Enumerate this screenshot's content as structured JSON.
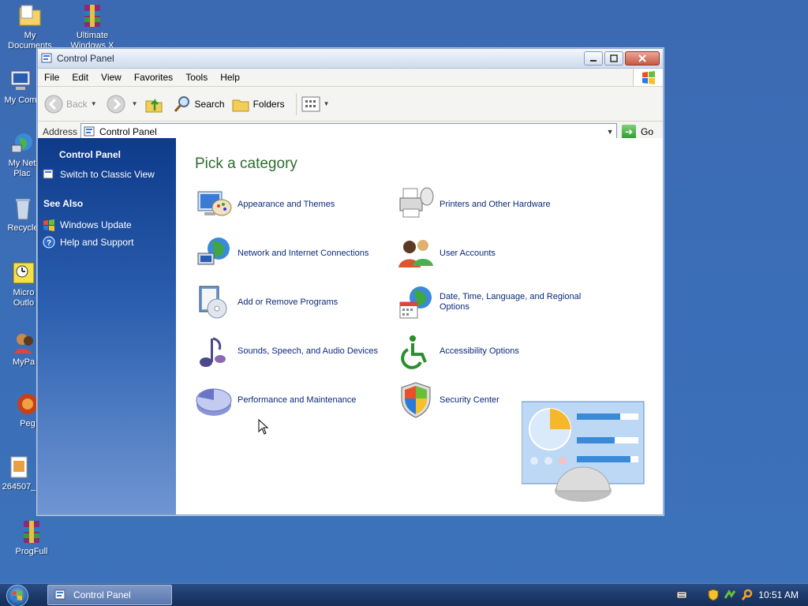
{
  "desktop": {
    "icons": [
      {
        "label": "My\nDocuments"
      },
      {
        "label": "Ultimate\nWindows X"
      },
      {
        "label": "My Com"
      },
      {
        "label": "My Net\nPlac"
      },
      {
        "label": "Recycle"
      },
      {
        "label": "Micro\nOutlo"
      },
      {
        "label": "MyPa"
      },
      {
        "label": "Peg"
      },
      {
        "label": "264507_"
      },
      {
        "label": "ProgFull"
      }
    ]
  },
  "window": {
    "title": "Control Panel",
    "menu": [
      "File",
      "Edit",
      "View",
      "Favorites",
      "Tools",
      "Help"
    ],
    "toolbar": {
      "back": "Back",
      "search": "Search",
      "folders": "Folders"
    },
    "address": {
      "label": "Address",
      "value": "Control Panel",
      "go": "Go"
    }
  },
  "taskpane": {
    "title": "Control Panel",
    "switch_link": "Switch to Classic View",
    "see_also_heading": "See Also",
    "see_also": [
      "Windows Update",
      "Help and Support"
    ]
  },
  "main": {
    "heading": "Pick a category",
    "categories": [
      {
        "label": "Appearance and Themes",
        "icon": "appearance-themes-icon"
      },
      {
        "label": "Printers and Other Hardware",
        "icon": "printer-hardware-icon"
      },
      {
        "label": "Network and Internet Connections",
        "icon": "network-internet-icon"
      },
      {
        "label": "User Accounts",
        "icon": "user-accounts-icon"
      },
      {
        "label": "Add or Remove Programs",
        "icon": "add-remove-programs-icon"
      },
      {
        "label": "Date, Time, Language, and Regional Options",
        "icon": "date-time-language-icon"
      },
      {
        "label": "Sounds, Speech, and Audio Devices",
        "icon": "sounds-audio-icon"
      },
      {
        "label": "Accessibility Options",
        "icon": "accessibility-icon"
      },
      {
        "label": "Performance and Maintenance",
        "icon": "performance-maintenance-icon"
      },
      {
        "label": "Security Center",
        "icon": "security-center-icon"
      }
    ]
  },
  "taskbar": {
    "task_button": "Control Panel",
    "clock": "10:51 AM"
  },
  "colors": {
    "desktop": "#3a6fb8",
    "taskpane_top": "#0e3a8a",
    "heading_green": "#2c6e2c",
    "link_blue": "#0a2a7a"
  }
}
